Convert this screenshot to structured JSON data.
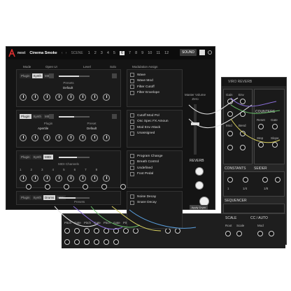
{
  "app": {
    "brand": "nest",
    "preset_name": "Cinema Smoke",
    "scene_label": "SCENE",
    "scenes": [
      "1",
      "2",
      "3",
      "4",
      "5",
      "6",
      "7",
      "8",
      "9",
      "10",
      "11",
      "12"
    ],
    "active_scene": "6",
    "sound_button": "SOUND"
  },
  "columns": {
    "mode": "Mode",
    "open_ui": "Open UI",
    "level": "Level",
    "solo": "Solo",
    "mod_assign": "Modulation Assign"
  },
  "slots": [
    {
      "chips": [
        "Plugin",
        "Synth",
        "MIDI"
      ],
      "active_chip": "Synth",
      "label": "Presets",
      "value": "Default",
      "level": 0.65
    },
    {
      "chips": [
        "Plugin",
        "Synth",
        "MIDI"
      ],
      "active_chip": "Plugin",
      "label_left": "Plugin",
      "label_right": "Preset",
      "value_left": "Apertile",
      "value_right": "Default",
      "level": 0.5
    },
    {
      "chips": [
        "Plugin",
        "Synth",
        "MIDI"
      ],
      "active_chip": "MIDI",
      "label": "MIDI Channels",
      "numbers": [
        "1",
        "2",
        "3",
        "4",
        "5",
        "6",
        "7",
        "8"
      ],
      "level": 0.6
    },
    {
      "chips": [
        "Plugin",
        "Synth",
        "Drums",
        "MIDI"
      ],
      "active_chip": "Drums",
      "label": "Presets",
      "value": "Big Ole Sights",
      "level": 0.55
    }
  ],
  "mod_blocks": [
    [
      "Wave",
      "Wave Mod",
      "Filter Cutoff",
      "Filter Envelope"
    ],
    [
      "Cutoff Mod Pol",
      "Osc Spec FX Amoun",
      "Mod Env Attack",
      "Unassigned"
    ],
    [
      "Program Change",
      "Breath Control",
      "Undefined",
      "Foot Pedal"
    ],
    [
      "Noise Decay",
      "Snare Decay",
      "Snare Reverb",
      "Snare Pitch"
    ]
  ],
  "mod_blocks_prefix": [
    "",
    "",
    "1 2 3 4",
    ""
  ],
  "master": {
    "volume_label": "Master Volume",
    "volume_value": "Zero",
    "reverb_label": "REVERB",
    "reverb_button": "Apply Dryer"
  },
  "rack": {
    "title": "VIRO REVERB",
    "counters": "COUNTERS",
    "constants": "CONSTANTS",
    "seider": "SEIDER",
    "sequencer": "SEQUENCER",
    "labels": [
      "Gain",
      "Env",
      "Mod",
      "Bend",
      "Reset",
      "Gate",
      "Step",
      "Slope",
      "Div",
      "Div"
    ],
    "values": [
      "1",
      "1/4",
      "1/8"
    ]
  },
  "strip": {
    "labels": [
      "Pitch",
      "Gate",
      "Pitch",
      "Gate",
      "Pitch",
      "Gate",
      "Pitch",
      "Gate",
      "Pitch",
      "Gate"
    ],
    "mid_label": "MAPPER",
    "scale_label": "SCALE",
    "cc_label": "CC / AUTO",
    "scale_items": [
      "Root",
      "Scale",
      "Ionian"
    ],
    "cc_items": [
      "Mod"
    ]
  },
  "colors": {
    "bg": "#141414",
    "panel": "#1b1b1b",
    "accent": "#e6e6e6",
    "logo_red": "#e03030",
    "wire_purple": "#8a6fd8",
    "wire_green": "#6cc36c",
    "wire_yellow": "#d8d060",
    "wire_blue": "#5aa0e0",
    "wire_white": "#e8e8e8"
  }
}
